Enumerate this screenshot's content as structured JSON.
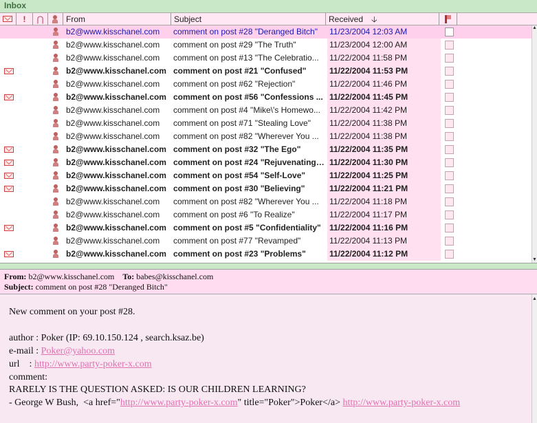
{
  "window": {
    "title": "Inbox"
  },
  "columns": {
    "from": "From",
    "subject": "Subject",
    "received": "Received",
    "sort_arrow": "🡣"
  },
  "messages": [
    {
      "from": "b2@www.kisschanel.com",
      "subject": "comment on post #28 \"Deranged Bitch\"",
      "received": "11/23/2004 12:03 AM",
      "unread": false,
      "selected": true
    },
    {
      "from": "b2@www.kisschanel.com",
      "subject": "comment on post #29 \"The Truth\"",
      "received": "11/23/2004 12:00 AM",
      "unread": false,
      "selected": false
    },
    {
      "from": "b2@www.kisschanel.com",
      "subject": "comment on post #13 \"The Celebratio...",
      "received": "11/22/2004 11:58 PM",
      "unread": false,
      "selected": false
    },
    {
      "from": "b2@www.kisschanel.com",
      "subject": "comment on post #21 \"Confused\"",
      "received": "11/22/2004 11:53 PM",
      "unread": true,
      "selected": false
    },
    {
      "from": "b2@www.kisschanel.com",
      "subject": "comment on post #62 \"Rejection\"",
      "received": "11/22/2004 11:46 PM",
      "unread": false,
      "selected": false
    },
    {
      "from": "b2@www.kisschanel.com",
      "subject": "comment on post #56 \"Confessions ...",
      "received": "11/22/2004 11:45 PM",
      "unread": true,
      "selected": false
    },
    {
      "from": "b2@www.kisschanel.com",
      "subject": "comment on post #4 \"Mike\\'s Homewo...",
      "received": "11/22/2004 11:42 PM",
      "unread": false,
      "selected": false
    },
    {
      "from": "b2@www.kisschanel.com",
      "subject": "comment on post #71 \"Stealing Love\"",
      "received": "11/22/2004 11:38 PM",
      "unread": false,
      "selected": false
    },
    {
      "from": "b2@www.kisschanel.com",
      "subject": "comment on post #82 \"Wherever You ...",
      "received": "11/22/2004 11:38 PM",
      "unread": false,
      "selected": false
    },
    {
      "from": "b2@www.kisschanel.com",
      "subject": "comment on post #32 \"The Ego\"",
      "received": "11/22/2004 11:35 PM",
      "unread": true,
      "selected": false
    },
    {
      "from": "b2@www.kisschanel.com",
      "subject": "comment on post #24 \"Rejuvenating ...",
      "received": "11/22/2004 11:30 PM",
      "unread": true,
      "selected": false
    },
    {
      "from": "b2@www.kisschanel.com",
      "subject": "comment on post #54 \"Self-Love\"",
      "received": "11/22/2004 11:25 PM",
      "unread": true,
      "selected": false
    },
    {
      "from": "b2@www.kisschanel.com",
      "subject": "comment on post #30 \"Believing\"",
      "received": "11/22/2004 11:21 PM",
      "unread": true,
      "selected": false
    },
    {
      "from": "b2@www.kisschanel.com",
      "subject": "comment on post #82 \"Wherever You ...",
      "received": "11/22/2004 11:18 PM",
      "unread": false,
      "selected": false
    },
    {
      "from": "b2@www.kisschanel.com",
      "subject": "comment on post #6 \"To Realize\"",
      "received": "11/22/2004 11:17 PM",
      "unread": false,
      "selected": false
    },
    {
      "from": "b2@www.kisschanel.com",
      "subject": "comment on post #5 \"Confidentiality\"",
      "received": "11/22/2004 11:16 PM",
      "unread": true,
      "selected": false
    },
    {
      "from": "b2@www.kisschanel.com",
      "subject": "comment on post #77 \"Revamped\"",
      "received": "11/22/2004 11:13 PM",
      "unread": false,
      "selected": false
    },
    {
      "from": "b2@www.kisschanel.com",
      "subject": "comment on post #23 \"Problems\"",
      "received": "11/22/2004 11:12 PM",
      "unread": true,
      "selected": false
    }
  ],
  "preview": {
    "from_label": "From:",
    "from_value": "b2@www.kisschanel.com",
    "to_label": "To:",
    "to_value": "babes@kisschanel.com",
    "subject_label": "Subject:",
    "subject_value": "comment on post #28 \"Deranged Bitch\"",
    "lines": {
      "l1": "New comment on your post #28.",
      "l2": "author : Poker (IP: 69.10.150.124 , search.ksaz.be)",
      "l3_prefix": "e-mail : ",
      "l3_link": "Poker@yahoo.com",
      "l4_prefix": "url    : ",
      "l4_link": "http://www.party-poker-x.com",
      "l5": "comment:",
      "l6": "RARELY IS THE QUESTION ASKED: IS OUR CHILDREN LEARNING?",
      "l7_a": "- George W Bush,  <a href=\"",
      "l7_link1": "http://www.party-poker-x.com",
      "l7_b": "\" title=\"Poker\">Poker</a> ",
      "l7_link2": "http://www.party-poker-x.com"
    }
  }
}
